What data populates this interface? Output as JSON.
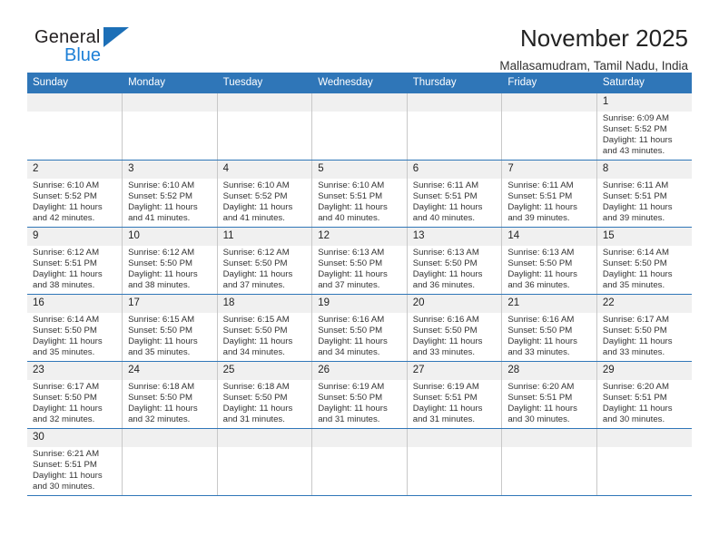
{
  "brand": {
    "name_top": "General",
    "name_bottom": "Blue",
    "accent_color": "#1c7fd6",
    "triangle_color": "#1c6fb7"
  },
  "header": {
    "title": "November 2025",
    "location": "Mallasamudram, Tamil Nadu, India"
  },
  "calendar": {
    "header_bg": "#2f76b8",
    "daynum_bg": "#f0f0f0",
    "weekdays": [
      "Sunday",
      "Monday",
      "Tuesday",
      "Wednesday",
      "Thursday",
      "Friday",
      "Saturday"
    ],
    "weeks": [
      [
        {
          "day": "",
          "blank": true
        },
        {
          "day": "",
          "blank": true
        },
        {
          "day": "",
          "blank": true
        },
        {
          "day": "",
          "blank": true
        },
        {
          "day": "",
          "blank": true
        },
        {
          "day": "",
          "blank": true
        },
        {
          "day": "1",
          "sunrise": "Sunrise: 6:09 AM",
          "sunset": "Sunset: 5:52 PM",
          "daylight1": "Daylight: 11 hours",
          "daylight2": "and 43 minutes."
        }
      ],
      [
        {
          "day": "2",
          "sunrise": "Sunrise: 6:10 AM",
          "sunset": "Sunset: 5:52 PM",
          "daylight1": "Daylight: 11 hours",
          "daylight2": "and 42 minutes."
        },
        {
          "day": "3",
          "sunrise": "Sunrise: 6:10 AM",
          "sunset": "Sunset: 5:52 PM",
          "daylight1": "Daylight: 11 hours",
          "daylight2": "and 41 minutes."
        },
        {
          "day": "4",
          "sunrise": "Sunrise: 6:10 AM",
          "sunset": "Sunset: 5:52 PM",
          "daylight1": "Daylight: 11 hours",
          "daylight2": "and 41 minutes."
        },
        {
          "day": "5",
          "sunrise": "Sunrise: 6:10 AM",
          "sunset": "Sunset: 5:51 PM",
          "daylight1": "Daylight: 11 hours",
          "daylight2": "and 40 minutes."
        },
        {
          "day": "6",
          "sunrise": "Sunrise: 6:11 AM",
          "sunset": "Sunset: 5:51 PM",
          "daylight1": "Daylight: 11 hours",
          "daylight2": "and 40 minutes."
        },
        {
          "day": "7",
          "sunrise": "Sunrise: 6:11 AM",
          "sunset": "Sunset: 5:51 PM",
          "daylight1": "Daylight: 11 hours",
          "daylight2": "and 39 minutes."
        },
        {
          "day": "8",
          "sunrise": "Sunrise: 6:11 AM",
          "sunset": "Sunset: 5:51 PM",
          "daylight1": "Daylight: 11 hours",
          "daylight2": "and 39 minutes."
        }
      ],
      [
        {
          "day": "9",
          "sunrise": "Sunrise: 6:12 AM",
          "sunset": "Sunset: 5:51 PM",
          "daylight1": "Daylight: 11 hours",
          "daylight2": "and 38 minutes."
        },
        {
          "day": "10",
          "sunrise": "Sunrise: 6:12 AM",
          "sunset": "Sunset: 5:50 PM",
          "daylight1": "Daylight: 11 hours",
          "daylight2": "and 38 minutes."
        },
        {
          "day": "11",
          "sunrise": "Sunrise: 6:12 AM",
          "sunset": "Sunset: 5:50 PM",
          "daylight1": "Daylight: 11 hours",
          "daylight2": "and 37 minutes."
        },
        {
          "day": "12",
          "sunrise": "Sunrise: 6:13 AM",
          "sunset": "Sunset: 5:50 PM",
          "daylight1": "Daylight: 11 hours",
          "daylight2": "and 37 minutes."
        },
        {
          "day": "13",
          "sunrise": "Sunrise: 6:13 AM",
          "sunset": "Sunset: 5:50 PM",
          "daylight1": "Daylight: 11 hours",
          "daylight2": "and 36 minutes."
        },
        {
          "day": "14",
          "sunrise": "Sunrise: 6:13 AM",
          "sunset": "Sunset: 5:50 PM",
          "daylight1": "Daylight: 11 hours",
          "daylight2": "and 36 minutes."
        },
        {
          "day": "15",
          "sunrise": "Sunrise: 6:14 AM",
          "sunset": "Sunset: 5:50 PM",
          "daylight1": "Daylight: 11 hours",
          "daylight2": "and 35 minutes."
        }
      ],
      [
        {
          "day": "16",
          "sunrise": "Sunrise: 6:14 AM",
          "sunset": "Sunset: 5:50 PM",
          "daylight1": "Daylight: 11 hours",
          "daylight2": "and 35 minutes."
        },
        {
          "day": "17",
          "sunrise": "Sunrise: 6:15 AM",
          "sunset": "Sunset: 5:50 PM",
          "daylight1": "Daylight: 11 hours",
          "daylight2": "and 35 minutes."
        },
        {
          "day": "18",
          "sunrise": "Sunrise: 6:15 AM",
          "sunset": "Sunset: 5:50 PM",
          "daylight1": "Daylight: 11 hours",
          "daylight2": "and 34 minutes."
        },
        {
          "day": "19",
          "sunrise": "Sunrise: 6:16 AM",
          "sunset": "Sunset: 5:50 PM",
          "daylight1": "Daylight: 11 hours",
          "daylight2": "and 34 minutes."
        },
        {
          "day": "20",
          "sunrise": "Sunrise: 6:16 AM",
          "sunset": "Sunset: 5:50 PM",
          "daylight1": "Daylight: 11 hours",
          "daylight2": "and 33 minutes."
        },
        {
          "day": "21",
          "sunrise": "Sunrise: 6:16 AM",
          "sunset": "Sunset: 5:50 PM",
          "daylight1": "Daylight: 11 hours",
          "daylight2": "and 33 minutes."
        },
        {
          "day": "22",
          "sunrise": "Sunrise: 6:17 AM",
          "sunset": "Sunset: 5:50 PM",
          "daylight1": "Daylight: 11 hours",
          "daylight2": "and 33 minutes."
        }
      ],
      [
        {
          "day": "23",
          "sunrise": "Sunrise: 6:17 AM",
          "sunset": "Sunset: 5:50 PM",
          "daylight1": "Daylight: 11 hours",
          "daylight2": "and 32 minutes."
        },
        {
          "day": "24",
          "sunrise": "Sunrise: 6:18 AM",
          "sunset": "Sunset: 5:50 PM",
          "daylight1": "Daylight: 11 hours",
          "daylight2": "and 32 minutes."
        },
        {
          "day": "25",
          "sunrise": "Sunrise: 6:18 AM",
          "sunset": "Sunset: 5:50 PM",
          "daylight1": "Daylight: 11 hours",
          "daylight2": "and 31 minutes."
        },
        {
          "day": "26",
          "sunrise": "Sunrise: 6:19 AM",
          "sunset": "Sunset: 5:50 PM",
          "daylight1": "Daylight: 11 hours",
          "daylight2": "and 31 minutes."
        },
        {
          "day": "27",
          "sunrise": "Sunrise: 6:19 AM",
          "sunset": "Sunset: 5:51 PM",
          "daylight1": "Daylight: 11 hours",
          "daylight2": "and 31 minutes."
        },
        {
          "day": "28",
          "sunrise": "Sunrise: 6:20 AM",
          "sunset": "Sunset: 5:51 PM",
          "daylight1": "Daylight: 11 hours",
          "daylight2": "and 30 minutes."
        },
        {
          "day": "29",
          "sunrise": "Sunrise: 6:20 AM",
          "sunset": "Sunset: 5:51 PM",
          "daylight1": "Daylight: 11 hours",
          "daylight2": "and 30 minutes."
        }
      ],
      [
        {
          "day": "30",
          "sunrise": "Sunrise: 6:21 AM",
          "sunset": "Sunset: 5:51 PM",
          "daylight1": "Daylight: 11 hours",
          "daylight2": "and 30 minutes."
        },
        {
          "day": "",
          "blank": true
        },
        {
          "day": "",
          "blank": true
        },
        {
          "day": "",
          "blank": true
        },
        {
          "day": "",
          "blank": true
        },
        {
          "day": "",
          "blank": true
        },
        {
          "day": "",
          "blank": true
        }
      ]
    ]
  }
}
